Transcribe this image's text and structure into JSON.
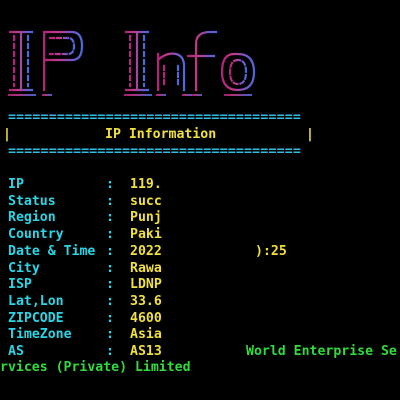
{
  "banner": {
    "logo_text": "IP_Info",
    "colors": [
      "#b0247a",
      "#c23a86",
      "#7a54c4",
      "#4b6ad8"
    ]
  },
  "rule_text": "====================================",
  "header": {
    "left_bar": "|",
    "title": "IP Information",
    "right_bar": "|"
  },
  "separator": ":",
  "rows": [
    {
      "key": "IP",
      "value": "119.",
      "tail": ""
    },
    {
      "key": "Status",
      "value": "succ",
      "tail": ""
    },
    {
      "key": "Region",
      "value": "Punj",
      "tail": ""
    },
    {
      "key": "Country",
      "value": "Paki",
      "tail": ""
    },
    {
      "key": "Date & Time",
      "value": "2022",
      "tail": "):25"
    },
    {
      "key": "City",
      "value": "Rawa",
      "tail": ""
    },
    {
      "key": "ISP",
      "value": "LDNP",
      "tail": ""
    },
    {
      "key": "Lat,Lon",
      "value": "33.6",
      "tail": ""
    },
    {
      "key": "ZIPCODE",
      "value": "4600",
      "tail": ""
    },
    {
      "key": "TimeZone",
      "value": "Asia",
      "tail": ""
    },
    {
      "key": "AS",
      "value": "AS13",
      "tail": "World Enterprise Se"
    }
  ],
  "wrap_line": "rvices (Private) Limited",
  "colors": {
    "background": "#000000",
    "key": "#2bd6e6",
    "value": "#f0e040",
    "rule": "#2bc0e4",
    "wrap": "#2fdc3c"
  }
}
